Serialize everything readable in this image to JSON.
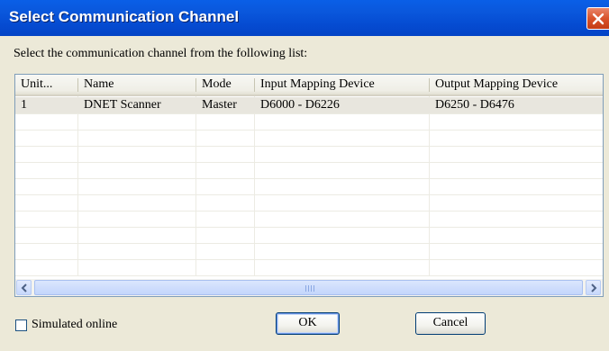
{
  "window": {
    "title": "Select Communication Channel",
    "close_icon": "close-x-icon"
  },
  "instruction": "Select the communication channel from the following list:",
  "table": {
    "columns": [
      "Unit...",
      "Name",
      "Mode",
      "Input Mapping Device",
      "Output Mapping Device"
    ],
    "rows": [
      {
        "unit": "1",
        "name": "DNET Scanner",
        "mode": "Master",
        "input": "D6000 - D6226",
        "output": "D6250 - D6476"
      }
    ],
    "selected_row": 1
  },
  "scrollbar": {
    "left_icon": "arrow-left-icon",
    "right_icon": "arrow-right-icon"
  },
  "simulated_online": {
    "label": "Simulated online",
    "checked": false
  },
  "buttons": {
    "ok": "OK",
    "cancel": "Cancel"
  },
  "colors": {
    "titlebar": "#0a58dd",
    "dialog_bg": "#ece9d8",
    "selected_row": "#e8e6de",
    "close_button": "#d9532b"
  }
}
